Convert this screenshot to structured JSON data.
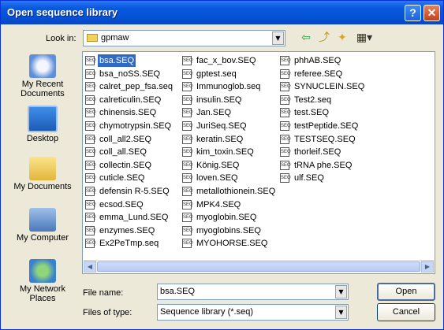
{
  "window": {
    "title": "Open sequence library",
    "help_glyph": "?",
    "close_glyph": "✕"
  },
  "lookin": {
    "label": "Look in:",
    "value": "gpmaw"
  },
  "toolbar": {
    "back_glyph": "⇦",
    "up_glyph": "⤴",
    "newfolder_glyph": "✦",
    "views_glyph": "▦▾"
  },
  "places": [
    {
      "label_line1": "My Recent",
      "label_line2": "Documents"
    },
    {
      "label_line1": "Desktop",
      "label_line2": ""
    },
    {
      "label_line1": "My Documents",
      "label_line2": ""
    },
    {
      "label_line1": "My Computer",
      "label_line2": ""
    },
    {
      "label_line1": "My Network",
      "label_line2": "Places"
    }
  ],
  "files": {
    "column1": [
      "bsa.SEQ",
      "bsa_noSS.SEQ",
      "calret_pep_fsa.seq",
      "calreticulin.SEQ",
      "chinensis.SEQ",
      "chymotrypsin.SEQ",
      "coll_all2.SEQ",
      "coll_all.SEQ",
      "collectin.SEQ",
      "cuticle.SEQ",
      "defensin R-5.SEQ",
      "ecsod.SEQ",
      "emma_Lund.SEQ",
      "enzymes.SEQ",
      "Ex2PeTmp.seq"
    ],
    "column2": [
      "fac_x_bov.SEQ",
      "gptest.seq",
      "Immunoglob.seq",
      "insulin.SEQ",
      "Jan.SEQ",
      "JuriSeq.SEQ",
      "keratin.SEQ",
      "kim_toxin.SEQ",
      "König.SEQ",
      "loven.SEQ",
      "metallothionein.SEQ",
      "MPK4.SEQ",
      "myoglobin.SEQ",
      "myoglobins.SEQ",
      "MYOHORSE.SEQ"
    ],
    "column3": [
      "phhAB.SEQ",
      "referee.SEQ",
      "SYNUCLEIN.SEQ",
      "Test2.seq",
      "test.SEQ",
      "testPeptide.SEQ",
      "TESTSEQ.SEQ",
      "thorleif.SEQ",
      "tRNA phe.SEQ",
      "ulf.SEQ"
    ],
    "selected": "bsa.SEQ",
    "icon_glyph": "SEQ"
  },
  "form": {
    "filename_label": "File name:",
    "filename_value": "bsa.SEQ",
    "filetype_label": "Files of type:",
    "filetype_value": "Sequence library (*.seq)",
    "open_label": "Open",
    "cancel_label": "Cancel"
  },
  "colors": {
    "title_bar": "#0552d6",
    "selection": "#316ac5",
    "dialog_bg": "#ece9d8"
  }
}
